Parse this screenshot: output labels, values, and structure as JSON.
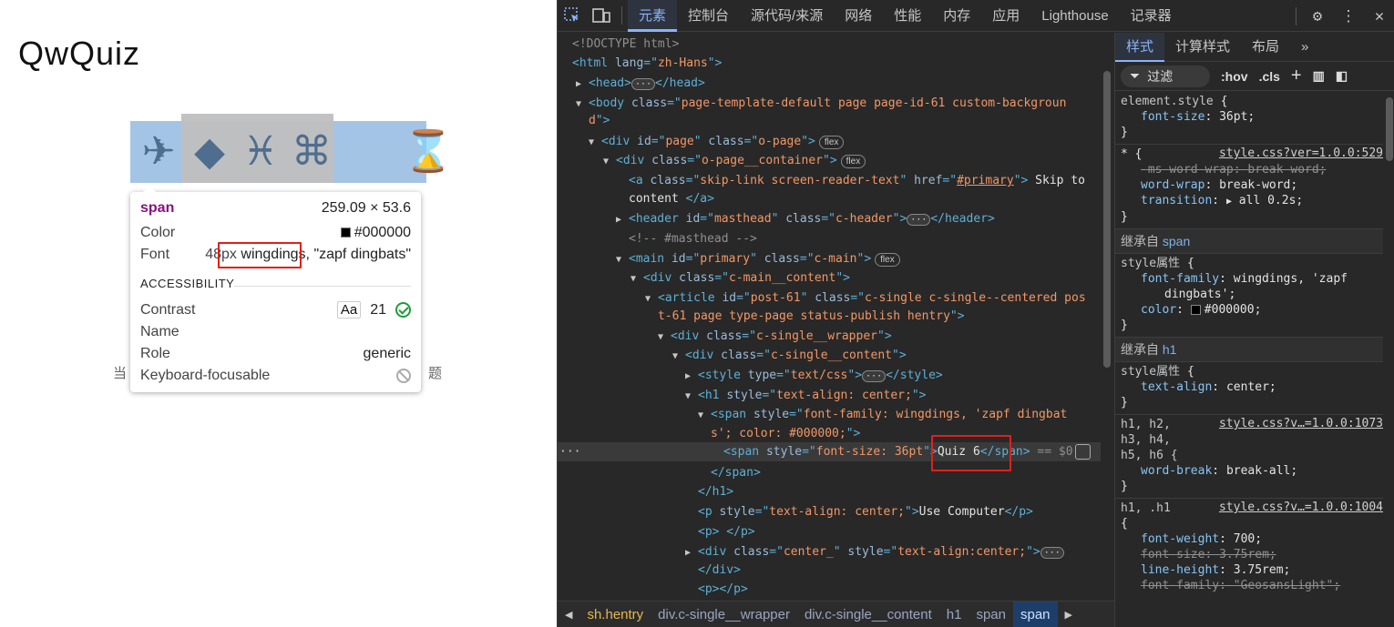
{
  "page": {
    "logo": "QwQuiz",
    "glyphs": [
      "✈",
      "◆",
      "♓",
      "⌘",
      "⌛"
    ],
    "behind_left": "当",
    "behind_right": "题"
  },
  "tooltip": {
    "tag": "span",
    "dims": "259.09 × 53.6",
    "color_label": "Color",
    "color_value": "#000000",
    "font_label": "Font",
    "font_size": "48px",
    "font_highlight": "wingdings,",
    "font_rest": "\"zapf dingbats\"",
    "section": "ACCESSIBILITY",
    "contrast_label": "Contrast",
    "contrast_aa": "Aa",
    "contrast_value": "21",
    "name_label": "Name",
    "role_label": "Role",
    "role_value": "generic",
    "keyboard_label": "Keyboard-focusable"
  },
  "devtools": {
    "tabs": [
      "元素",
      "控制台",
      "源代码/来源",
      "网络",
      "性能",
      "内存",
      "应用",
      "Lighthouse",
      "记录器"
    ],
    "active_tab": "元素",
    "styles_tabs": [
      "样式",
      "计算样式",
      "布局"
    ],
    "filter": "过滤",
    "hov": ":hov",
    "cls": ".cls",
    "breadcrumbs": [
      "sh.hentry",
      "div.c-single__wrapper",
      "div.c-single__content",
      "h1",
      "span",
      "span"
    ]
  },
  "dom": {
    "doctype": "<!DOCTYPE html>",
    "html_lang": "zh-Hans",
    "body_class_1": "page-template-default page page-id-61 custom-backgroun",
    "body_class_2": "d",
    "page_id": "page",
    "page_class": "o-page",
    "container_class": "o-page__container",
    "skip_class": "skip-link screen-reader-text",
    "skip_href": "#primary",
    "skip_text_1": "Skip to",
    "skip_text_2": "content",
    "header_id": "masthead",
    "header_class": "c-header",
    "masthead_comment": "<!-- #masthead -->",
    "main_id": "primary",
    "main_class": "c-main",
    "main_inner_class": "c-main__content",
    "article_id": "post-61",
    "article_class_1": "c-single c-single--centered pos",
    "article_class_2": "t-61 page type-page status-publish hentry",
    "wrapper_class": "c-single__wrapper",
    "content_class": "c-single__content",
    "style_type": "text/css",
    "h1_style": "text-align: center;",
    "span_style_1": "font-family: wingdings, 'zapf dingbat",
    "span_style_2": "s'; color: #000000;",
    "inner_span_style": "font-size: 36pt",
    "inner_span_text": "Quiz 6",
    "eq": "== $0",
    "p_style": "text-align: center;",
    "p_text": "Use Computer",
    "center_class": "center_",
    "center_style": "text-align:center;",
    "flex": "flex"
  },
  "styles": {
    "element_selector": "element.style",
    "element_prop": "font-size",
    "element_val": "36pt",
    "star_src": "style.css?ver=1.0.0:529",
    "star_p1": "-ms-word-wrap",
    "star_v1": "break-word",
    "star_p2": "word-wrap",
    "star_v2": "break-word",
    "star_p3": "transition",
    "star_v3": "all 0.2s",
    "inherit_span_label": "继承自",
    "inherit_span_tag": "span",
    "style_attr": "style属性",
    "span_font_prop": "font-family",
    "span_font_val_1": "wingdings, 'zapf",
    "span_font_val_2": "dingbats'",
    "span_color_prop": "color",
    "span_color_val": "#000000",
    "inherit_h1_tag": "h1",
    "h1_align_prop": "text-align",
    "h1_align_val": "center",
    "hsel_1": "h1, h2,",
    "hsel_2": "h3, h4,",
    "hsel_3": "h5, h6 {",
    "hsrc": "style.css?v…=1.0.0:1073",
    "wb_prop": "word-break",
    "wb_val": "break-all",
    "h1sel": "h1, .h1",
    "h1src": "style.css?v…=1.0.0:1004",
    "fw_prop": "font-weight",
    "fw_val": "700",
    "fs_prop": "font-size",
    "fs_val": "3.75rem",
    "lh_prop": "line-height",
    "lh_val": "3.75rem",
    "ff_prop": "font-family",
    "ff_val": "\"GeosansLight\""
  }
}
